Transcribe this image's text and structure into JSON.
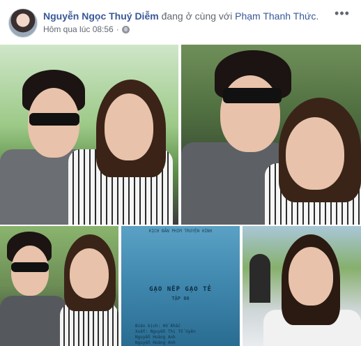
{
  "post": {
    "author": "Nguyễn Ngọc Thuý Diễm",
    "relation": "đang ở cùng với",
    "tagged": "Phạm Thanh Thức",
    "tagged_suffix": ".",
    "timestamp": "Hôm qua lúc 08:56",
    "privacy_icon": "globe-icon",
    "more_label": "•••"
  },
  "script_page": {
    "company": "KỊCH BẢN PHIM TRUYỆN HÌNH",
    "title": "GẠO NẾP GẠO TẺ",
    "episode": "TẬP 80",
    "credits": [
      "Biên kịch: Hồ Khắc",
      "Xuất: Nguyễn Thị Tố Uyên",
      "Nguyễn Hoàng Anh",
      "Nguyễn Hoàng Anh"
    ]
  },
  "colors": {
    "link": "#385898",
    "text": "#1d2129",
    "meta": "#616770"
  }
}
